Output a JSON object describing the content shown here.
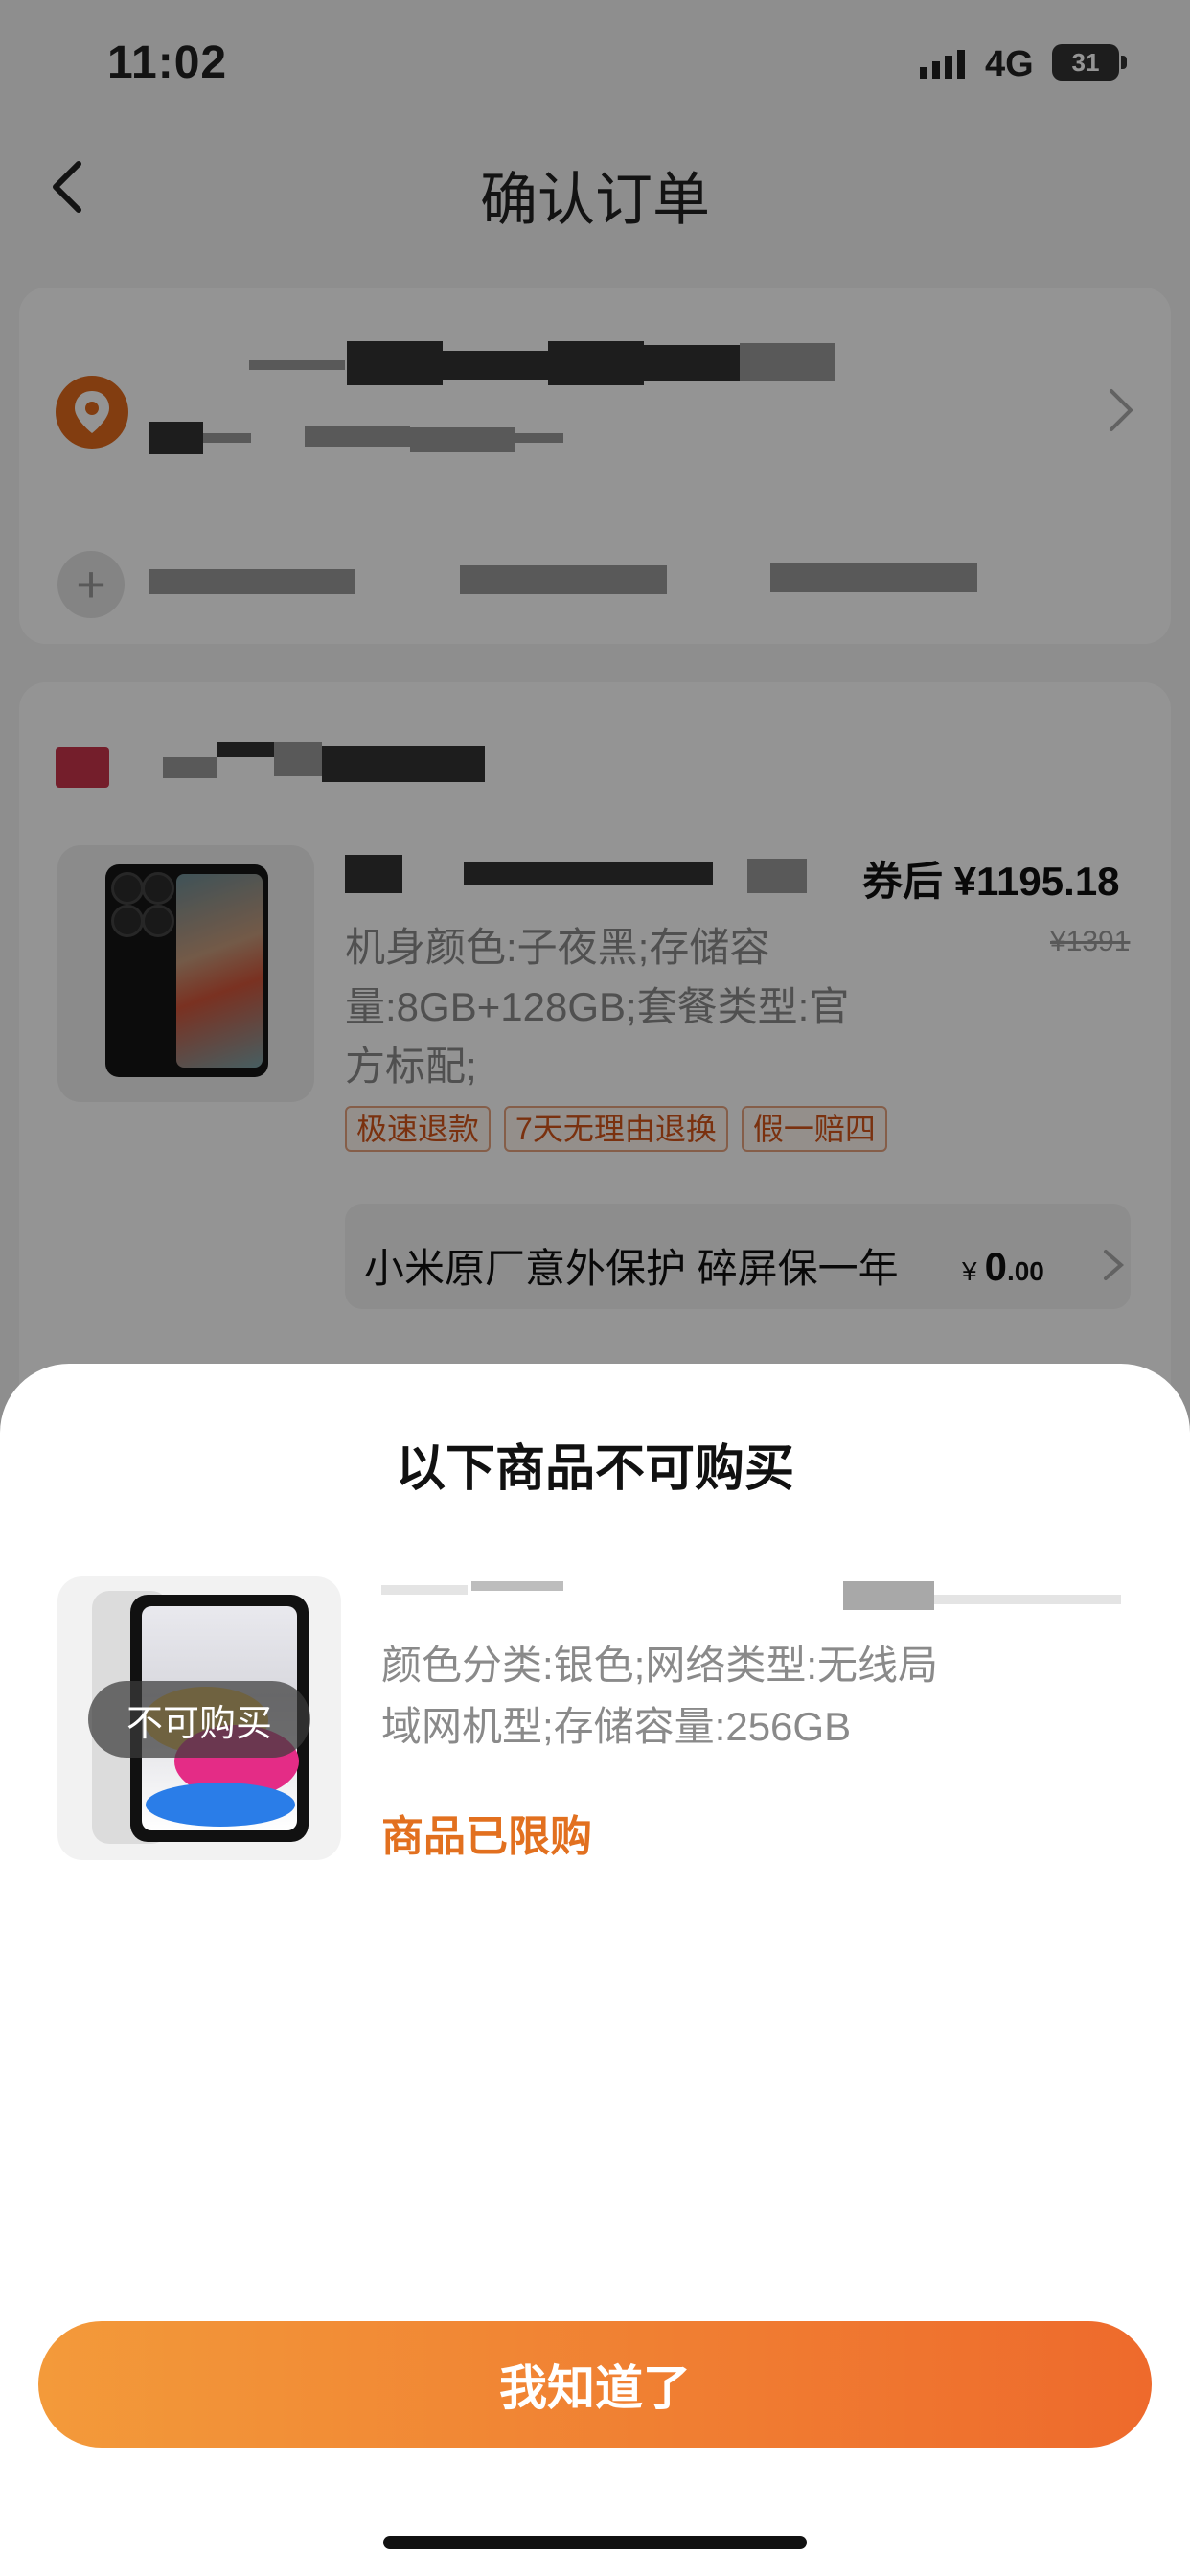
{
  "status_bar": {
    "time": "11:02",
    "network": "4G",
    "battery": "31"
  },
  "nav": {
    "title": "确认订单"
  },
  "product": {
    "price_after_coupon": "券后 ¥1195.18",
    "price_original": "¥1391",
    "specs": "机身颜色:子夜黑;存储容量:8GB+128GB;套餐类型:官方标配;",
    "tags": [
      "极速退款",
      "7天无理由退换",
      "假一赔四"
    ],
    "service": {
      "label": "小米原厂意外保护 碎屏保一年",
      "currency": "¥",
      "price_int": "0",
      "price_dec": ".00"
    }
  },
  "sheet": {
    "title": "以下商品不可购买",
    "item": {
      "badge": "不可购买",
      "specs": "颜色分类:银色;网络类型:无线局域网机型;存储容量:256GB",
      "status": "商品已限购"
    },
    "confirm_label": "我知道了"
  },
  "colors": {
    "accent": "#ee6a2c",
    "status_orange": "#e2701f"
  },
  "icons": [
    "back-arrow-icon",
    "location-pin-icon",
    "chevron-right-icon",
    "plus-icon",
    "shop-icon",
    "signal-icon",
    "battery-icon"
  ]
}
